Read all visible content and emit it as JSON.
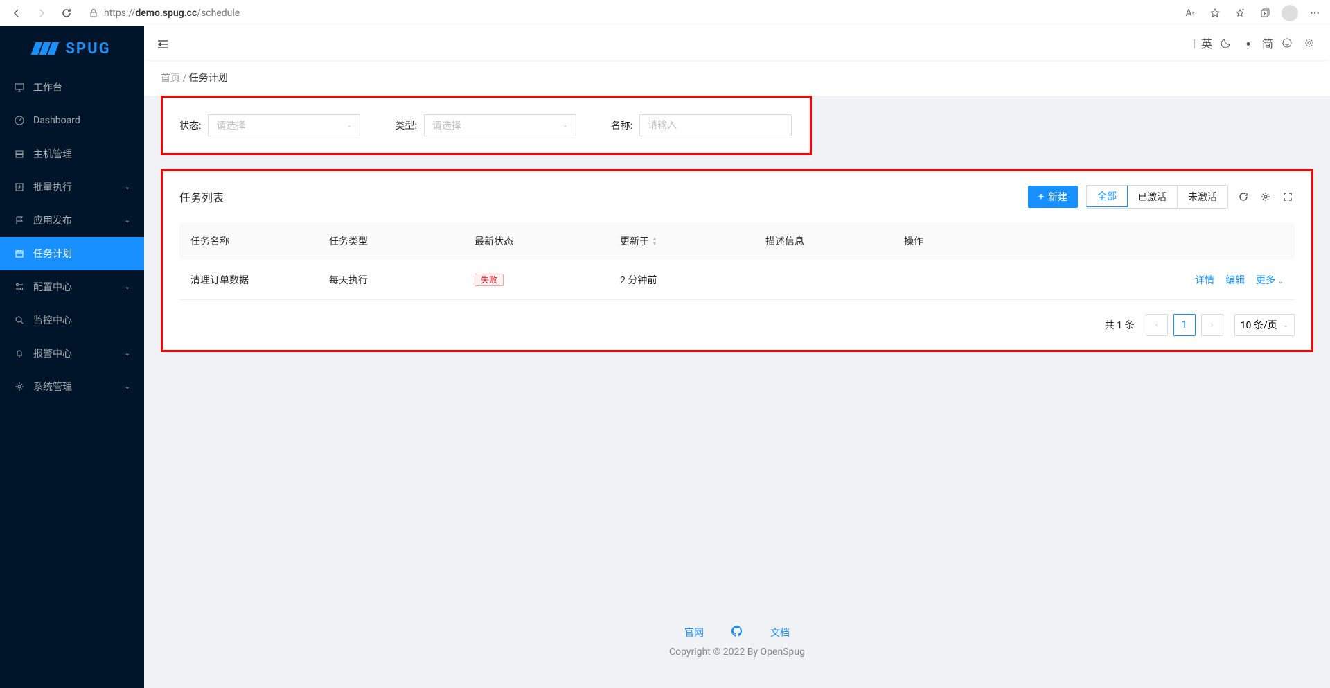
{
  "browser": {
    "url_host": "demo.spug.cc",
    "url_prefix": "https://",
    "url_path": "/schedule"
  },
  "logo_text": "SPUG",
  "sidebar": {
    "items": [
      {
        "label": "工作台",
        "active": false,
        "expandable": false
      },
      {
        "label": "Dashboard",
        "active": false,
        "expandable": false
      },
      {
        "label": "主机管理",
        "active": false,
        "expandable": false
      },
      {
        "label": "批量执行",
        "active": false,
        "expandable": true
      },
      {
        "label": "应用发布",
        "active": false,
        "expandable": true
      },
      {
        "label": "任务计划",
        "active": true,
        "expandable": false
      },
      {
        "label": "配置中心",
        "active": false,
        "expandable": true
      },
      {
        "label": "监控中心",
        "active": false,
        "expandable": false
      },
      {
        "label": "报警中心",
        "active": false,
        "expandable": true
      },
      {
        "label": "系统管理",
        "active": false,
        "expandable": true
      }
    ]
  },
  "topbar": {
    "lang1": "英",
    "lang2": "简"
  },
  "breadcrumb": {
    "home": "首页",
    "sep": " / ",
    "current": "任务计划"
  },
  "filter": {
    "status_label": "状态:",
    "status_placeholder": "请选择",
    "type_label": "类型:",
    "type_placeholder": "请选择",
    "name_label": "名称:",
    "name_placeholder": "请输入"
  },
  "table": {
    "title": "任务列表",
    "new_btn": "新建",
    "tabs": {
      "all": "全部",
      "active": "已激活",
      "inactive": "未激活"
    },
    "columns": {
      "name": "任务名称",
      "type": "任务类型",
      "status": "最新状态",
      "updated": "更新于",
      "desc": "描述信息",
      "action": "操作"
    },
    "rows": [
      {
        "name": "清理订单数据",
        "type": "每天执行",
        "status": "失败",
        "updated": "2 分钟前",
        "desc": ""
      }
    ],
    "actions": {
      "detail": "详情",
      "edit": "编辑",
      "more": "更多"
    }
  },
  "pagination": {
    "total": "共 1 条",
    "current": "1",
    "size": "10 条/页"
  },
  "footer": {
    "link1": "官网",
    "link2": "文档",
    "copyright": "Copyright © 2022 By OpenSpug"
  }
}
